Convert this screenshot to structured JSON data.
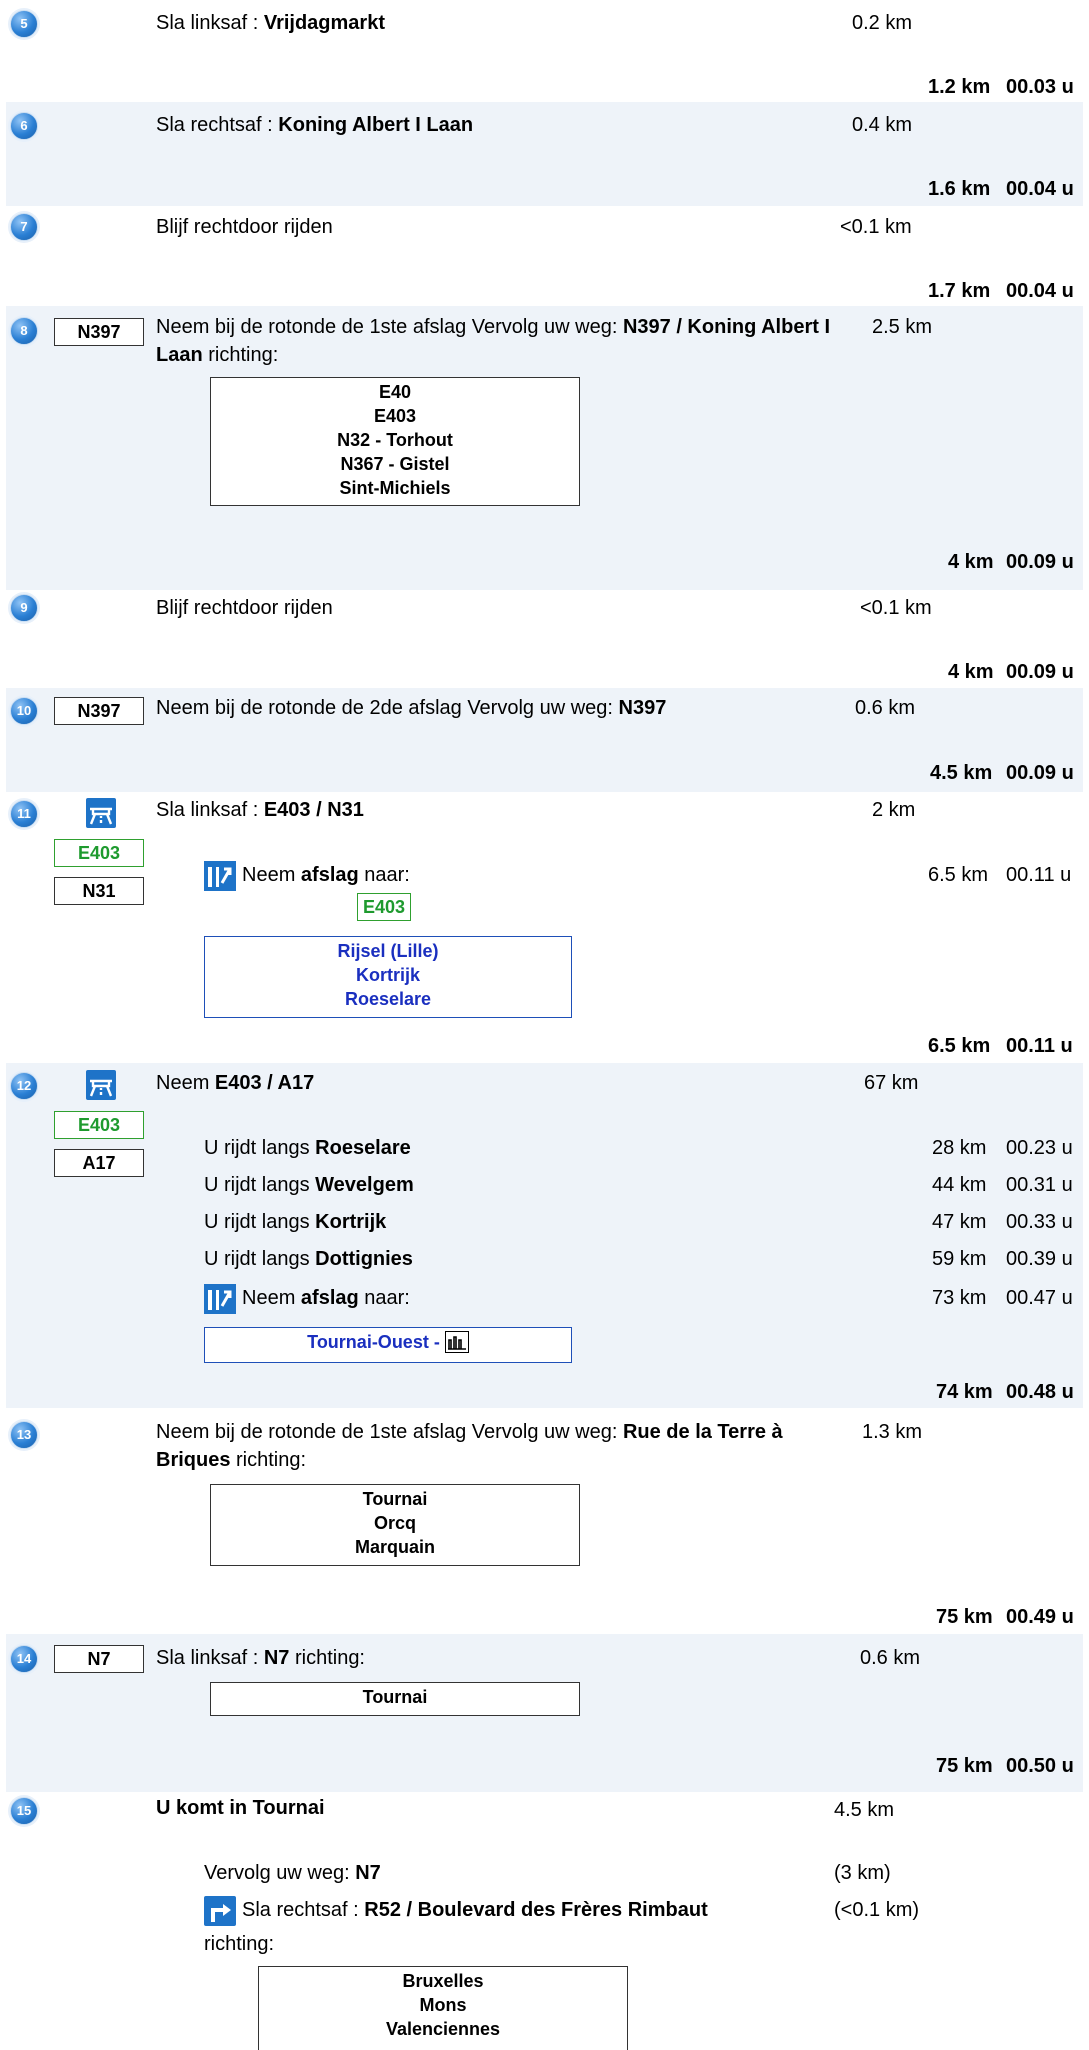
{
  "steps": {
    "s5": {
      "num": "5",
      "prefix": "Sla linksaf : ",
      "road": "Vrijdagmarkt",
      "dist": "0.2 km",
      "total_km": "1.2 km",
      "total_time": "00.03 u"
    },
    "s6": {
      "num": "6",
      "prefix": "Sla rechtsaf : ",
      "road": "Koning Albert I Laan",
      "dist": "0.4 km",
      "total_km": "1.6 km",
      "total_time": "00.04 u"
    },
    "s7": {
      "num": "7",
      "text": "Blijf rechtdoor rijden",
      "dist": "<0.1 km",
      "total_km": "1.7 km",
      "total_time": "00.04 u"
    },
    "s8": {
      "num": "8",
      "shield": "N397",
      "prefix": "Neem bij de rotonde de 1ste afslag Vervolg uw weg: ",
      "road": "N397 / Koning Albert I Laan",
      "suffix": " richting:",
      "dist": "2.5 km",
      "sign": [
        "E40",
        "E403",
        "N32 - Torhout",
        "N367 - Gistel",
        "Sint-Michiels"
      ],
      "total_km": "4 km",
      "total_time": "00.09 u"
    },
    "s9": {
      "num": "9",
      "text": "Blijf rechtdoor rijden",
      "dist": "<0.1 km",
      "total_km": "4 km",
      "total_time": "00.09 u"
    },
    "s10": {
      "num": "10",
      "shield": "N397",
      "prefix": "Neem bij de rotonde de 2de afslag Vervolg uw weg: ",
      "road": "N397",
      "dist": "0.6 km",
      "total_km": "4.5 km",
      "total_time": "00.09 u"
    },
    "s11": {
      "num": "11",
      "shield1": "E403",
      "shield2": "N31",
      "prefix": "Sla linksaf : ",
      "road": "E403 / N31",
      "dist": "2 km",
      "exit_prefix": "Neem ",
      "exit_bold": "afslag",
      "exit_suffix": " naar:",
      "exit_dist": "6.5 km",
      "exit_time": "00.11 u",
      "exit_shield": "E403",
      "sign": [
        "Rijsel (Lille)",
        "Kortrijk",
        "Roeselare"
      ],
      "total_km": "6.5 km",
      "total_time": "00.11 u"
    },
    "s12": {
      "num": "12",
      "shield1": "E403",
      "shield2": "A17",
      "prefix": "Neem ",
      "road": "E403 / A17",
      "dist": "67 km",
      "via": [
        {
          "prefix": "U rijdt langs ",
          "place": "Roeselare",
          "dist": "28 km",
          "time": "00.23 u"
        },
        {
          "prefix": "U rijdt langs ",
          "place": "Wevelgem",
          "dist": "44 km",
          "time": "00.31 u"
        },
        {
          "prefix": "U rijdt langs ",
          "place": "Kortrijk",
          "dist": "47 km",
          "time": "00.33 u"
        },
        {
          "prefix": "U rijdt langs ",
          "place": "Dottignies",
          "dist": "59 km",
          "time": "00.39 u"
        }
      ],
      "exit_prefix": "Neem ",
      "exit_bold": "afslag",
      "exit_suffix": " naar:",
      "exit_dist": "73 km",
      "exit_time": "00.47 u",
      "sign": "Tournai-Ouest - ",
      "total_km": "74 km",
      "total_time": "00.48 u"
    },
    "s13": {
      "num": "13",
      "prefix": "Neem bij de rotonde de 1ste afslag Vervolg uw weg: ",
      "road": "Rue de la Terre à Briques",
      "suffix": " richting:",
      "dist": "1.3 km",
      "sign": [
        "Tournai",
        "Orcq",
        "Marquain"
      ],
      "total_km": "75 km",
      "total_time": "00.49 u"
    },
    "s14": {
      "num": "14",
      "shield": "N7",
      "prefix": "Sla linksaf : ",
      "road": "N7",
      "suffix": " richting:",
      "dist": "0.6 km",
      "sign": [
        "Tournai"
      ],
      "total_km": "75 km",
      "total_time": "00.50 u"
    },
    "s15": {
      "num": "15",
      "text": "U komt in Tournai",
      "dist": "4.5 km",
      "cont_prefix": "Vervolg uw weg: ",
      "cont_road": "N7",
      "cont_dist": "(3 km)",
      "turn_prefix": "Sla rechtsaf : ",
      "turn_road": "R52 / Boulevard des Frères Rimbaut",
      "turn_suffix": "richting:",
      "turn_dist": "(<0.1 km)",
      "sign": [
        "Bruxelles",
        "Mons",
        "Valenciennes"
      ]
    }
  }
}
